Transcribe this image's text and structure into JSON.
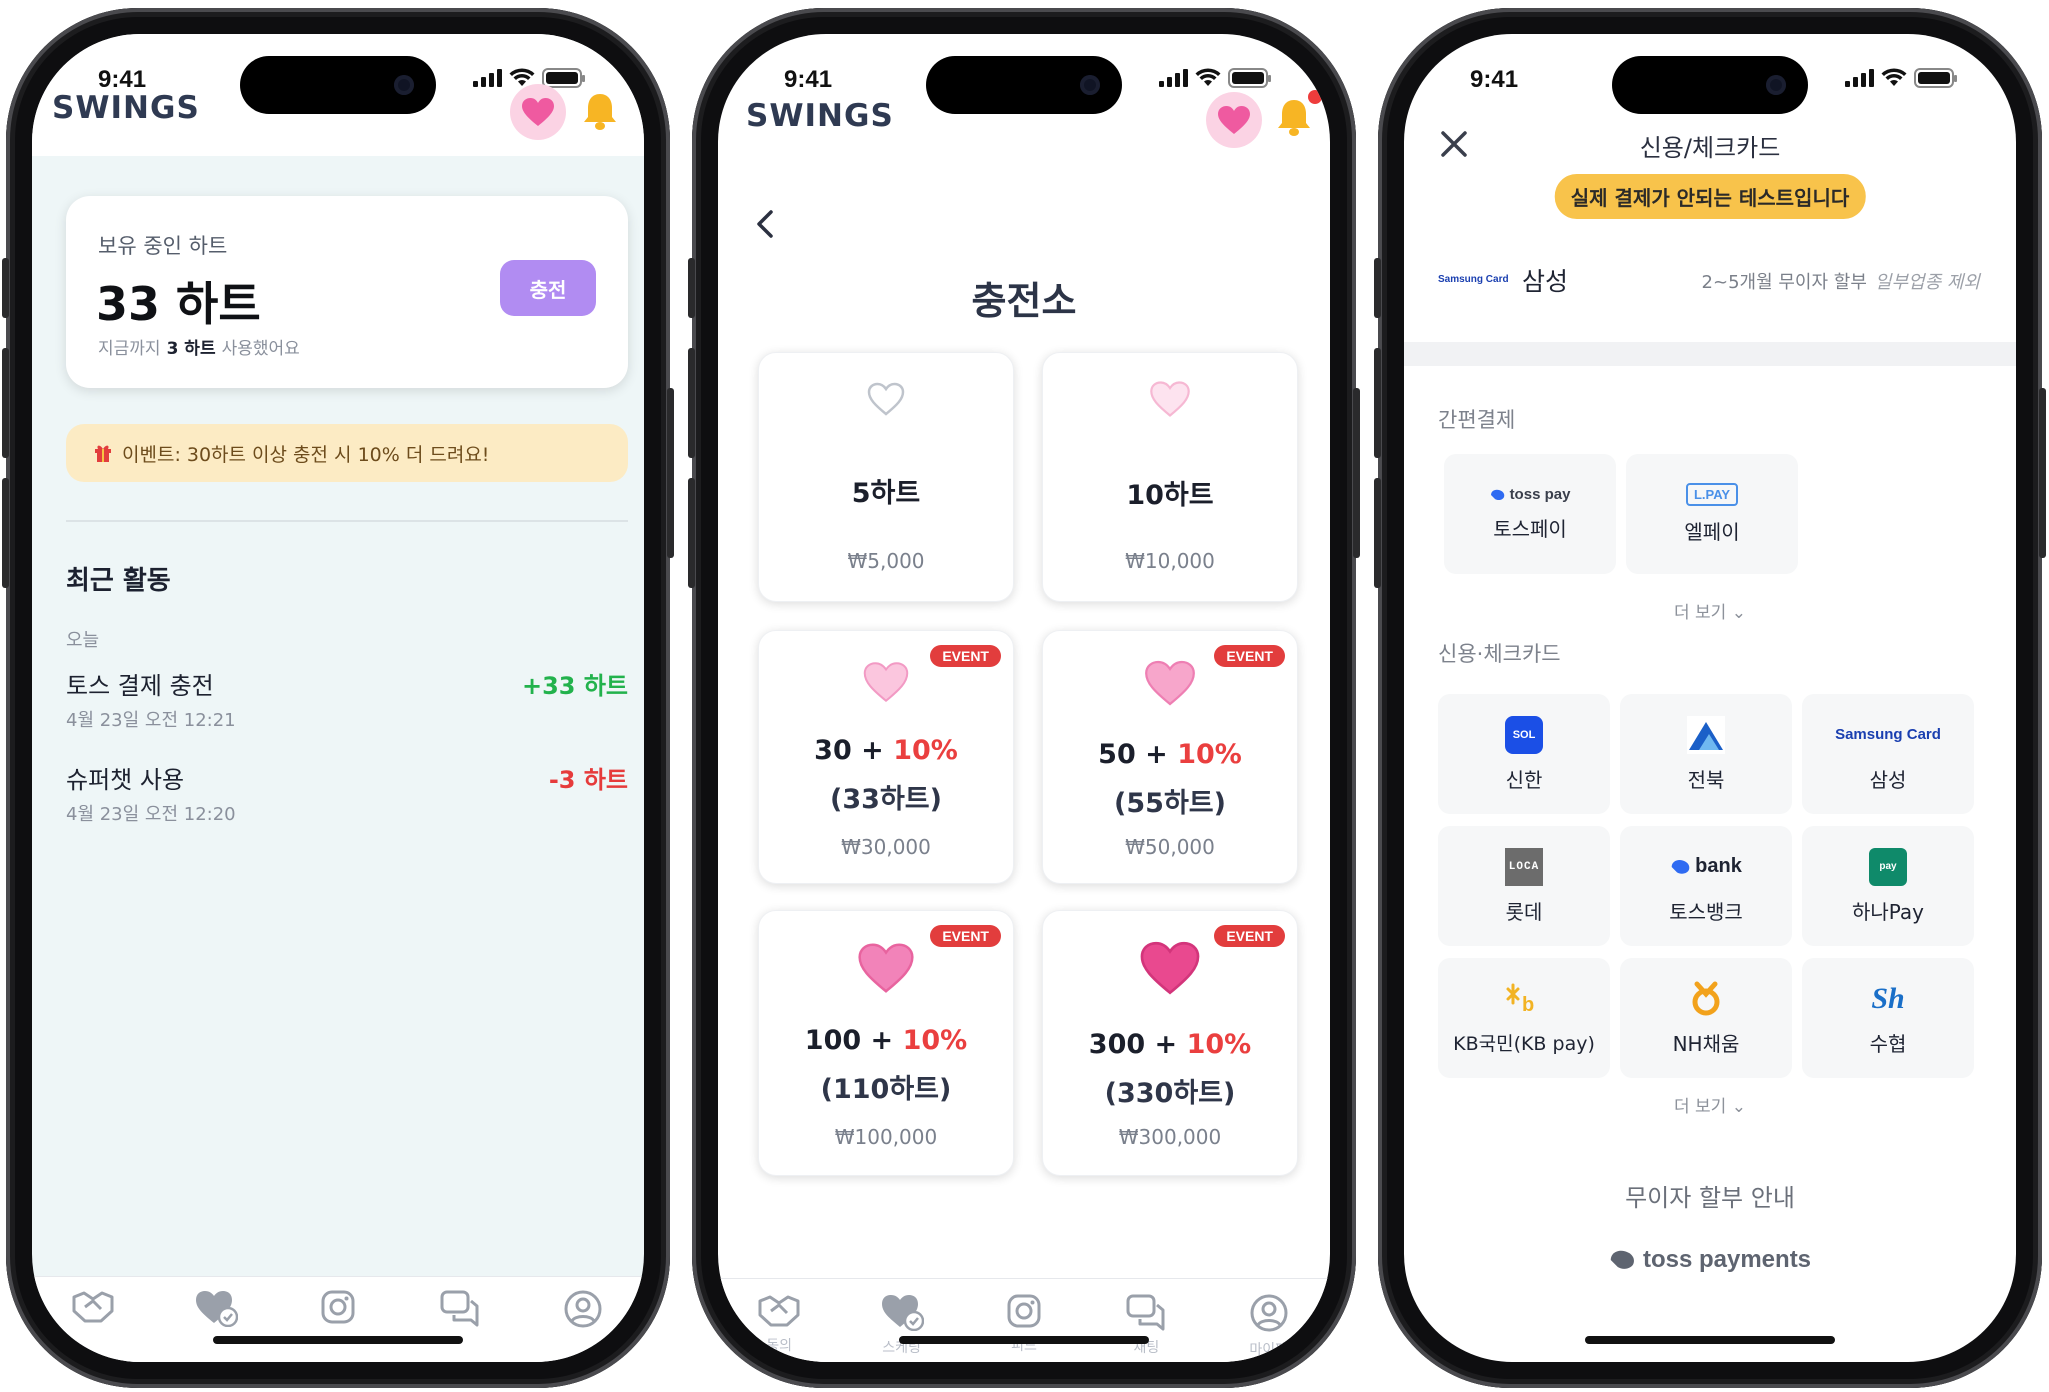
{
  "status": {
    "time": "9:41"
  },
  "app": {
    "brand": "SWINGS"
  },
  "screen1": {
    "balance_label": "보유 중인 하트",
    "balance_value": "33 하트",
    "usage_prefix": "지금까지",
    "usage_count": "3 하트",
    "usage_suffix": "사용했어요",
    "charge_button": "충전",
    "event_banner": "이벤트: 30하트 이상 충전 시 10% 더 드려요!",
    "recent_title": "최근 활동",
    "day_label": "오늘",
    "activities": [
      {
        "name": "토스 결제 충전",
        "amount": "+33 하트",
        "time": "4월 23일 오전 12:21",
        "color": "#22b24c"
      },
      {
        "name": "슈퍼챗 사용",
        "amount": "-3 하트",
        "time": "4월 23일 오전 12:20",
        "color": "#e63b3b"
      }
    ]
  },
  "screen2": {
    "title": "충전소",
    "event_badge": "EVENT",
    "packages": [
      {
        "name": "5하트",
        "price": "₩5,000"
      },
      {
        "name": "10하트",
        "price": "₩10,000"
      },
      {
        "base": "30 +",
        "pct": "10%",
        "bonus": "(33하트)",
        "price": "₩30,000"
      },
      {
        "base": "50 +",
        "pct": "10%",
        "bonus": "(55하트)",
        "price": "₩50,000"
      },
      {
        "base": "100 +",
        "pct": "10%",
        "bonus": "(110하트)",
        "price": "₩100,000"
      },
      {
        "base": "300 +",
        "pct": "10%",
        "bonus": "(330하트)",
        "price": "₩300,000"
      }
    ],
    "tabs": [
      "동의",
      "스케팅",
      "피드",
      "채팅",
      "마이페"
    ]
  },
  "screen3": {
    "title": "신용/체크카드",
    "test_notice": "실제 결제가 안되는 테스트입니다",
    "selected_card_logo": "Samsung Card",
    "selected_card": "삼성",
    "installment_note": "2~5개월 무이자 할부",
    "installment_exclude": "일부업종 제외",
    "simple_pay_label": "간편결제",
    "simple_pay": [
      {
        "logo": "toss pay",
        "label": "토스페이"
      },
      {
        "logo": "L.PAY",
        "label": "엘페이"
      }
    ],
    "more_label": "더 보기",
    "card_label": "신용·체크카드",
    "cards": [
      {
        "label": "신한",
        "icon": "sol-pay-icon"
      },
      {
        "label": "전북",
        "icon": "jb-icon"
      },
      {
        "label": "삼성",
        "icon": "samsung-card-icon",
        "logo": "Samsung Card"
      },
      {
        "label": "롯데",
        "icon": "loca-icon",
        "logo": "LOCA"
      },
      {
        "label": "토스뱅크",
        "icon": "toss-bank-icon",
        "logo": "bank"
      },
      {
        "label": "하나Pay",
        "icon": "hana-pay-icon"
      },
      {
        "label": "KB국민(KB pay)",
        "icon": "kb-icon"
      },
      {
        "label": "NH채움",
        "icon": "nh-icon"
      },
      {
        "label": "수협",
        "icon": "sh-icon",
        "logo": "Sh"
      }
    ],
    "installment_guide": "무이자 할부 안내",
    "footer_brand": "toss payments"
  }
}
